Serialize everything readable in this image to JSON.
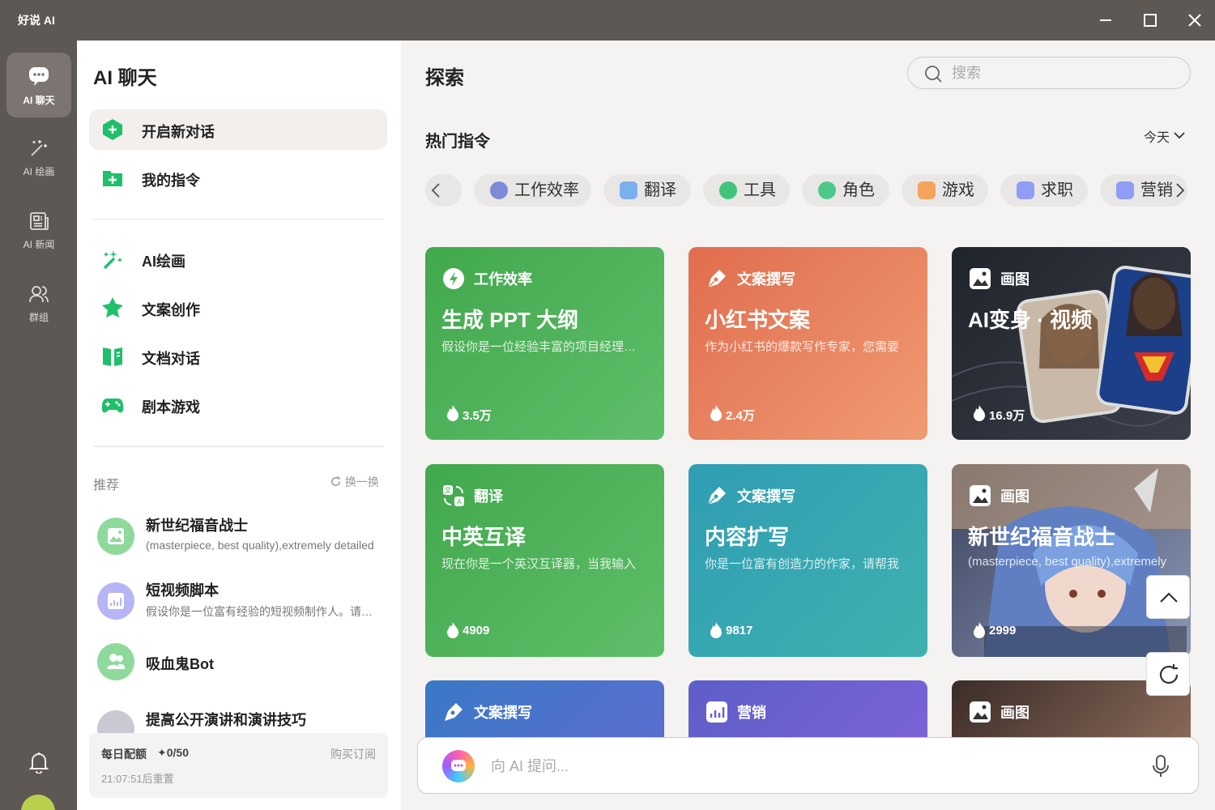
{
  "window": {
    "title": "好说 AI"
  },
  "rail": {
    "items": [
      {
        "label": "AI 聊天",
        "icon": "chat-icon",
        "active": true
      },
      {
        "label": "AI 绘画",
        "icon": "magic-wand-icon"
      },
      {
        "label": "AI 新闻",
        "icon": "news-icon"
      },
      {
        "label": "群组",
        "icon": "users-icon"
      }
    ]
  },
  "sidebar": {
    "title": "AI 聊天",
    "top_items": [
      {
        "label": "开启新对话",
        "icon": "plus-icon",
        "active": true
      },
      {
        "label": "我的指令",
        "icon": "folder-plus-icon"
      }
    ],
    "tools": [
      {
        "label": "AI绘画",
        "icon": "magic-wand-icon"
      },
      {
        "label": "文案创作",
        "icon": "star-icon"
      },
      {
        "label": "文档对话",
        "icon": "book-icon"
      },
      {
        "label": "剧本游戏",
        "icon": "gamepad-icon"
      }
    ],
    "recommend": {
      "title": "推荐",
      "refresh_label": "换一换",
      "items": [
        {
          "name": "新世纪福音战士",
          "desc": "(masterpiece, best quality),extremely detailed",
          "icon": "image-icon",
          "color": "#8fd99c"
        },
        {
          "name": "短视频脚本",
          "desc": "假设你是一位富有经验的短视频制作人。请帮我",
          "icon": "chart-icon",
          "color": "#b7b5f5"
        },
        {
          "name": "吸血鬼Bot",
          "desc": "",
          "icon": "users-icon",
          "color": "#8fd99c"
        },
        {
          "name": "提高公开演讲和演讲技巧",
          "desc": "",
          "icon": "chat-icon",
          "color": "#c9c9d4"
        }
      ]
    },
    "quota": {
      "title": "每日配额",
      "value": "✦0/50",
      "buy_label": "购买订阅",
      "reset": "21:07:51后重置"
    }
  },
  "main": {
    "title": "探索",
    "search_placeholder": "搜索",
    "section_title": "热门指令",
    "period": "今天",
    "categories": [
      {
        "label": "工作效率",
        "icon": "bolt-icon",
        "color": "#7b8bd8"
      },
      {
        "label": "翻译",
        "icon": "translate-icon",
        "color": "#7bb0ef"
      },
      {
        "label": "工具",
        "icon": "bulb-icon",
        "color": "#40c47a"
      },
      {
        "label": "角色",
        "icon": "users-icon",
        "color": "#4cc98a"
      },
      {
        "label": "游戏",
        "icon": "gamepad-icon",
        "color": "#f3a45a"
      },
      {
        "label": "求职",
        "icon": "job-icon",
        "color": "#8f9df5"
      },
      {
        "label": "营销",
        "icon": "chart-icon",
        "color": "#8f9df5"
      }
    ],
    "cards": [
      {
        "category": "工作效率",
        "icon": "bolt-icon",
        "title": "生成 PPT 大纲",
        "desc": "假设你是一位经验丰富的项目经理，请帮我生成",
        "count": "3.5万",
        "bg": "linear-gradient(135deg,#41a84d,#5fbe6a)"
      },
      {
        "category": "文案撰写",
        "icon": "pen-icon",
        "title": "小红书文案",
        "desc": "作为小红书的爆款写作专家，您需要",
        "count": "2.4万",
        "bg": "linear-gradient(135deg,#e06d4e,#f09b73)"
      },
      {
        "category": "画图",
        "icon": "image-icon",
        "title": "AI变身 · 视频",
        "desc": "",
        "count": "16.9万",
        "bg": "linear-gradient(135deg,#20242c,#3a3f4a)"
      },
      {
        "category": "翻译",
        "icon": "translate-icon",
        "title": "中英互译",
        "desc": "现在你是一个英汉互译器，当我输入",
        "count": "4909",
        "bg": "linear-gradient(135deg,#41a84d,#5fbe6a)"
      },
      {
        "category": "文案撰写",
        "icon": "pen-icon",
        "title": "内容扩写",
        "desc": "你是一位富有创造力的作家，请帮我",
        "count": "9817",
        "bg": "linear-gradient(135deg,#2f9db3,#3fb1b0)"
      },
      {
        "category": "画图",
        "icon": "image-icon",
        "title": "新世纪福音战士",
        "desc": "(masterpiece, best quality),extremely",
        "count": "2999",
        "bg": "linear-gradient(135deg,#3e4660,#8a97b6)"
      },
      {
        "category": "文案撰写",
        "icon": "pen-icon",
        "title": "",
        "desc": "",
        "count": "",
        "bg": "linear-gradient(135deg,#3a78c6,#5b6ed0)"
      },
      {
        "category": "营销",
        "icon": "chart-icon",
        "title": "",
        "desc": "",
        "count": "",
        "bg": "linear-gradient(135deg,#5d5ec8,#7b63d6)"
      },
      {
        "category": "画图",
        "icon": "image-icon",
        "title": "",
        "desc": "",
        "count": "",
        "bg": "linear-gradient(135deg,#3b2c28,#8a6a5a)"
      }
    ],
    "chat_placeholder": "向 AI 提问..."
  }
}
